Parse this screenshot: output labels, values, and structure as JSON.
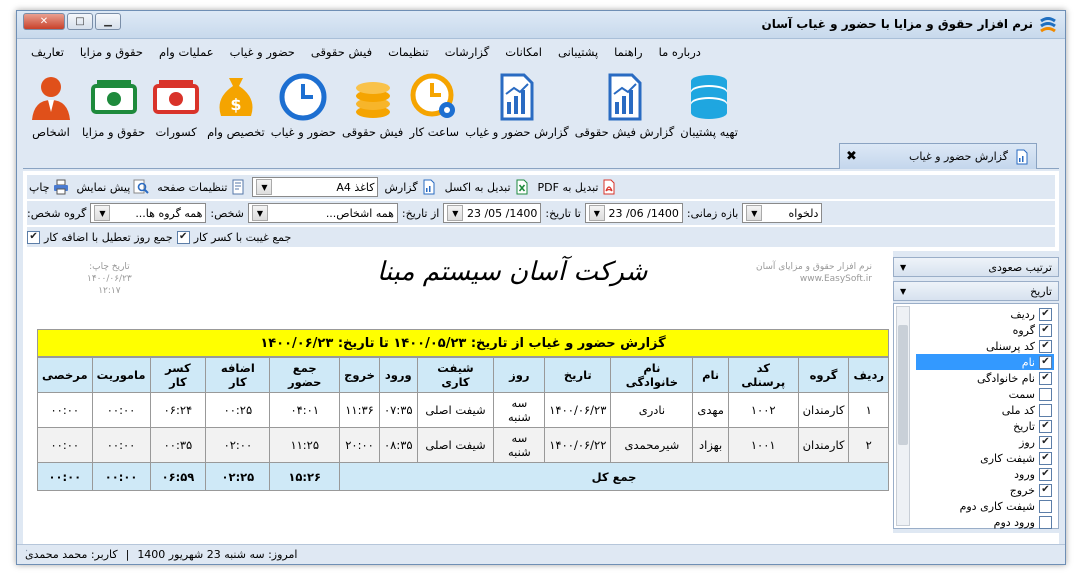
{
  "window": {
    "title": "نرم افزار حقوق و مزایا با حضور و غیاب آسان"
  },
  "menu": [
    "تعاریف",
    "حقوق و مزایا",
    "عملیات وام",
    "حضور و غیاب",
    "فیش حقوقی",
    "تنظیمات",
    "گزارشات",
    "امکانات",
    "پشتیبانی",
    "راهنما",
    "درباره ما"
  ],
  "ribbon": [
    {
      "label": "اشخاص",
      "icon": "person-icon"
    },
    {
      "label": "حقوق و مزایا",
      "icon": "money-icon"
    },
    {
      "label": "کسورات",
      "icon": "money-deduct-icon"
    },
    {
      "label": "تخصیص وام",
      "icon": "money-bag-icon"
    },
    {
      "label": "حضور و غیاب",
      "icon": "clock-icon"
    },
    {
      "label": "فیش حقوقی",
      "icon": "coins-icon"
    },
    {
      "label": "ساعت کار",
      "icon": "clock-gear-icon"
    },
    {
      "label": "گزارش حضور و غیاب",
      "icon": "report-chart-icon"
    },
    {
      "label": "گزارش فیش حقوقی",
      "icon": "report-chart-icon"
    },
    {
      "label": "تهیه پشتیبان",
      "icon": "database-icon"
    }
  ],
  "tab": {
    "label": "گزارش حضور و غیاب"
  },
  "toolbar": {
    "print": "چاپ",
    "preview": "پیش نمایش",
    "page_settings": "تنظیمات صفحه",
    "paper": "کاغذ A4",
    "report": "گزارش",
    "to_excel": "تبدیل به اکسل",
    "to_pdf": "تبدیل به PDF",
    "group_label": "گروه شخص:",
    "group_value": "همه گروه ها...",
    "person_label": "شخص:",
    "person_value": "همه اشخاص...",
    "from_label": "از تاریخ:",
    "from_value": "1400/ 05/ 23",
    "to_label": "تا تاریخ:",
    "to_value": "1400/ 06/ 23",
    "range_label": "بازه زمانی:",
    "range_value": "دلخواه",
    "sum_holiday": "جمع روز تعطیل با اضافه کار",
    "sum_absence": "جمع غیبت با کسر کار"
  },
  "report": {
    "company": "شرکت آسان سیستم مبنا",
    "print_date_label": "تاریخ چاپ:",
    "print_date": "۱۴۰۰/۰۶/۲۳",
    "print_time": "۱۲:۱۷",
    "brand_line1": "نرم افزار حقوق و مزایای آسان",
    "brand_line2": "www.EasySoft.ir",
    "title": "گزارش حضور و غیاب از تاریخ: ۱۴۰۰/۰۵/۲۳ تا تاریخ: ۱۴۰۰/۰۶/۲۳",
    "columns": [
      "ردیف",
      "گروه",
      "کد پرسنلی",
      "نام",
      "نام خانوادگی",
      "تاریخ",
      "روز",
      "شیفت کاری",
      "ورود",
      "خروج",
      "جمع حضور",
      "اضافه کار",
      "کسر کار",
      "ماموریت",
      "مرخصی"
    ],
    "rows": [
      [
        "۱",
        "کارمندان",
        "۱۰۰۲",
        "مهدی",
        "نادری",
        "۱۴۰۰/۰۶/۲۳",
        "سه شنبه",
        "شیفت اصلی",
        "۰۷:۳۵",
        "۱۱:۳۶",
        "۰۴:۰۱",
        "۰۰:۲۵",
        "۰۶:۲۴",
        "۰۰:۰۰",
        "۰۰:۰۰"
      ],
      [
        "۲",
        "کارمندان",
        "۱۰۰۱",
        "بهزاد",
        "شیرمحمدی",
        "۱۴۰۰/۰۶/۲۲",
        "سه شنبه",
        "شیفت اصلی",
        "۰۸:۳۵",
        "۲۰:۰۰",
        "۱۱:۲۵",
        "۰۲:۰۰",
        "۰۰:۳۵",
        "۰۰:۰۰",
        "۰۰:۰۰"
      ]
    ],
    "total_label": "جمع کل",
    "totals": [
      "۱۵:۲۶",
      "۰۲:۲۵",
      "۰۶:۵۹",
      "۰۰:۰۰",
      "۰۰:۰۰"
    ]
  },
  "side": {
    "sort_order": "ترتیب صعودی",
    "sort_field": "تاریخ",
    "fields": [
      {
        "label": "ردیف",
        "checked": true
      },
      {
        "label": "گروه",
        "checked": true
      },
      {
        "label": "کد پرسنلی",
        "checked": true
      },
      {
        "label": "نام",
        "checked": true,
        "highlight": true
      },
      {
        "label": "نام خانوادگی",
        "checked": true
      },
      {
        "label": "سمت",
        "checked": false
      },
      {
        "label": "کد ملی",
        "checked": false
      },
      {
        "label": "تاریخ",
        "checked": true
      },
      {
        "label": "روز",
        "checked": true
      },
      {
        "label": "شیفت کاری",
        "checked": true
      },
      {
        "label": "ورود",
        "checked": true
      },
      {
        "label": "خروج",
        "checked": true
      },
      {
        "label": "شیفت کاری دوم",
        "checked": false
      },
      {
        "label": "ورود دوم",
        "checked": false
      }
    ]
  },
  "status": {
    "today": "امروز: سه شنبه 23 شهریور 1400",
    "user": "کاربر: محمد محمدی"
  }
}
